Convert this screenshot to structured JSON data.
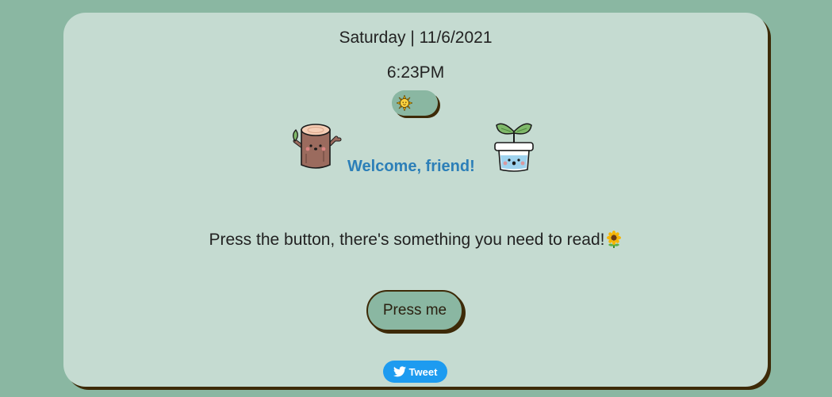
{
  "header": {
    "date": "Saturday | 11/6/2021",
    "time": "6:23PM"
  },
  "theme_toggle": {
    "icon": "sun-icon"
  },
  "welcome": {
    "text": "Welcome, friend!",
    "left_icon": "tree-stump-icon",
    "right_icon": "potted-sprout-icon"
  },
  "message": {
    "text": "Press the button, there's something you need to read!",
    "icon": "sunflower-icon"
  },
  "buttons": {
    "press_label": "Press me",
    "tweet_label": "Tweet",
    "tweet_icon": "twitter-bird-icon"
  },
  "colors": {
    "page_background": "#8ab7a2",
    "card_background": "#c5dbd1",
    "shadow": "#3d2a08",
    "welcome_text": "#2c7fb8",
    "tweet_button": "#1d9bf0"
  }
}
